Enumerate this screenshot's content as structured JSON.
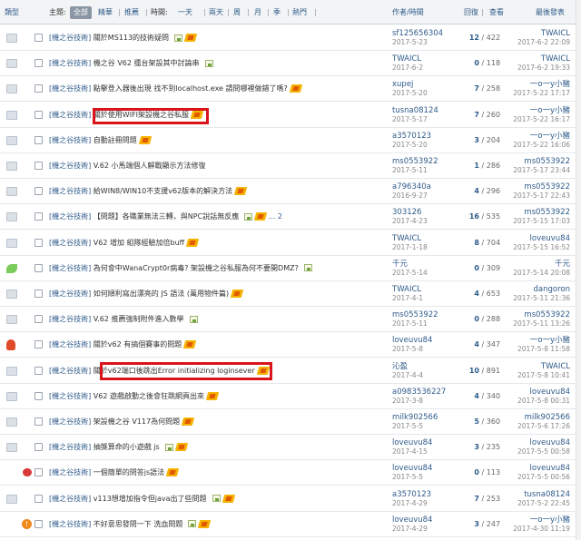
{
  "header": {
    "type_label": "類型",
    "topic_label": "主題:",
    "filters": [
      "全部",
      "精華",
      "推薦"
    ],
    "time_label": "時間:",
    "time_filters": [
      "一天",
      "兩天",
      "周",
      "月",
      "季"
    ],
    "hot_label": "熱門",
    "author_label": "作者/時間",
    "reply_label": "回復",
    "view_label": "查看",
    "last_label": "最後發表"
  },
  "rows": [
    {
      "icon": "folder",
      "category": "[機之谷技術]",
      "title": "關於MS113的技術疑問",
      "img": true,
      "hot": true,
      "attach": false,
      "pages": "",
      "author": "sf125656304",
      "date": "2017-5-23",
      "replies": "12",
      "views": "/ 422",
      "last_author": "TWAICL",
      "last_date": "2017-6-2 22:09"
    },
    {
      "icon": "folder",
      "category": "[機之谷技術]",
      "title": "機之谷 V62 擂台架設其中討論串",
      "img": true,
      "hot": false,
      "attach": false,
      "pages": "",
      "author": "TWAICL",
      "date": "2017-6-2",
      "replies": "0",
      "views": "/ 118",
      "last_author": "TWAICL",
      "last_date": "2017-6-2 19:33"
    },
    {
      "icon": "folder",
      "category": "[機之谷技術]",
      "title": "點擊登入器後出現 找不到localhost.exe 請問哪裡做錯了嗎?",
      "img": false,
      "hot": true,
      "attach": false,
      "pages": "",
      "author": "xupej",
      "date": "2017-5-20",
      "replies": "7",
      "views": "/ 258",
      "last_author": "一o一y小豬",
      "last_date": "2017-5-22 17:17"
    },
    {
      "icon": "folder",
      "category": "[機之谷技術]",
      "title": "關於使用WIFI架設機之谷私服",
      "img": false,
      "hot": true,
      "attach": false,
      "pages": "",
      "author": "tusna08124",
      "date": "2017-5-17",
      "replies": "7",
      "views": "/ 260",
      "last_author": "一o一y小豬",
      "last_date": "2017-5-22 16:17"
    },
    {
      "icon": "folder",
      "category": "[機之谷技術]",
      "title": "自動註冊問題",
      "img": false,
      "hot": true,
      "attach": false,
      "pages": "",
      "author": "a3570123",
      "date": "2017-5-20",
      "replies": "3",
      "views": "/ 204",
      "last_author": "一o一y小豬",
      "last_date": "2017-5-22 16:06"
    },
    {
      "icon": "folder",
      "category": "[機之谷技術]",
      "title": "V.62 小馬端個人解戰顯示方法修復",
      "img": false,
      "hot": false,
      "attach": false,
      "pages": "",
      "author": "ms0553922",
      "date": "2017-5-11",
      "replies": "1",
      "views": "/ 286",
      "last_author": "ms0553922",
      "last_date": "2017-5-17 23:44"
    },
    {
      "icon": "folder",
      "category": "[機之谷技術]",
      "title": "給WIN8/WIN10不支援v62版本的解決方法",
      "img": false,
      "hot": true,
      "attach": false,
      "pages": "",
      "author": "a796340a",
      "date": "2016-9-27",
      "replies": "4",
      "views": "/ 296",
      "last_author": "ms0553922",
      "last_date": "2017-5-17 22:43"
    },
    {
      "icon": "folder",
      "category": "[機之谷技術]",
      "title": "【問題】各職業無法三轉，與NPC說話無反應",
      "img": true,
      "hot": true,
      "attach": false,
      "pages": "... 2",
      "author": "303126",
      "date": "2017-4-23",
      "replies": "16",
      "views": "/ 535",
      "last_author": "ms0553922",
      "last_date": "2017-5-15 17:03"
    },
    {
      "icon": "folder",
      "category": "[機之谷技術]",
      "title": "V62 增加 組隊經驗加倍buff",
      "img": false,
      "hot": true,
      "attach": false,
      "pages": "",
      "author": "TWAICL",
      "date": "2017-1-18",
      "replies": "8",
      "views": "/ 704",
      "last_author": "loveuvu84",
      "last_date": "2017-5-15 16:52"
    },
    {
      "icon": "leaf",
      "category": "[機之谷技術]",
      "title": "為何會中WanaCrypt0r病毒? 架設機之谷私服為何不要開DMZ?",
      "img": true,
      "hot": false,
      "attach": false,
      "pages": "",
      "author": "千元",
      "date": "2017-5-14",
      "replies": "0",
      "views": "/ 309",
      "last_author": "千元",
      "last_date": "2017-5-14 20:08"
    },
    {
      "icon": "folder",
      "category": "[機之谷技術]",
      "title": "如何順利寫出漂亮的 JS 語法 (萬用物件篇)",
      "img": false,
      "hot": true,
      "attach": false,
      "pages": "",
      "author": "TWAICL",
      "date": "2017-4-1",
      "replies": "4",
      "views": "/ 653",
      "last_author": "dangoron",
      "last_date": "2017-5-11 21:36"
    },
    {
      "icon": "folder",
      "category": "[機之谷技術]",
      "title": "V.62 推薦強制附件進入數學",
      "img": true,
      "hot": false,
      "attach": false,
      "pages": "",
      "author": "ms0553922",
      "date": "2017-5-11",
      "replies": "0",
      "views": "/ 288",
      "last_author": "ms0553922",
      "last_date": "2017-5-11 13:26"
    },
    {
      "icon": "fire",
      "category": "[機之谷技術]",
      "title": "關於v62 有搞個賽事的問題",
      "img": false,
      "hot": true,
      "attach": false,
      "pages": "",
      "author": "loveuvu84",
      "date": "2017-5-8",
      "replies": "4",
      "views": "/ 347",
      "last_author": "一o一y小豬",
      "last_date": "2017-5-8 11:58"
    },
    {
      "icon": "folder",
      "category": "[機之谷技術]",
      "title": "關於v62端口後跳出Error initializing loginsever",
      "img": false,
      "hot": true,
      "attach": false,
      "pages": "",
      "author": "沁盈",
      "date": "2017-4-4",
      "replies": "10",
      "views": "/ 891",
      "last_author": "TWAICL",
      "last_date": "2017-5-8 10:41"
    },
    {
      "icon": "folder",
      "category": "[機之谷技術]",
      "title": "V62 遊戲啟動之後會狂跳網頁出來",
      "img": false,
      "hot": true,
      "attach": false,
      "pages": "",
      "author": "a0983536227",
      "date": "2017-3-8",
      "replies": "4",
      "views": "/ 340",
      "last_author": "loveuvu84",
      "last_date": "2017-5-8 00:31"
    },
    {
      "icon": "folder",
      "category": "[機之谷技術]",
      "title": "架設機之谷 V117為何問題",
      "img": false,
      "hot": true,
      "attach": false,
      "pages": "",
      "author": "milk902566",
      "date": "2017-5-5",
      "replies": "5",
      "views": "/ 360",
      "last_author": "milk902566",
      "last_date": "2017-5-6 17:26"
    },
    {
      "icon": "folder",
      "category": "[機之谷技術]",
      "title": "抽獎算命的小遊戲 js",
      "img": true,
      "hot": true,
      "attach": false,
      "pages": "",
      "author": "loveuvu84",
      "date": "2017-4-15",
      "replies": "3",
      "views": "/ 235",
      "last_author": "loveuvu84",
      "last_date": "2017-5-5 00:58"
    },
    {
      "icon": "heart",
      "category": "[機之谷技術]",
      "title": "一個簡單的問答js語法",
      "img": false,
      "hot": true,
      "attach": false,
      "pages": "",
      "author": "loveuvu84",
      "date": "2017-5-5",
      "replies": "0",
      "views": "/ 113",
      "last_author": "loveuvu84",
      "last_date": "2017-5-5 00:56"
    },
    {
      "icon": "folder",
      "category": "[機之谷技術]",
      "title": "v113想增加指令但java出了些問題",
      "img": true,
      "hot": true,
      "attach": false,
      "pages": "",
      "author": "a3570123",
      "date": "2017-4-29",
      "replies": "7",
      "views": "/ 253",
      "last_author": "tusna08124",
      "last_date": "2017-5-2 22:45"
    },
    {
      "icon": "warn",
      "category": "[機之谷技術]",
      "title": "不好意思發問一下 洗血問題",
      "img": true,
      "hot": true,
      "attach": false,
      "pages": "",
      "author": "loveuvu84",
      "date": "2017-4-29",
      "replies": "3",
      "views": "/ 247",
      "last_author": "一o一y小豬",
      "last_date": "2017-4-30 11:19"
    }
  ]
}
